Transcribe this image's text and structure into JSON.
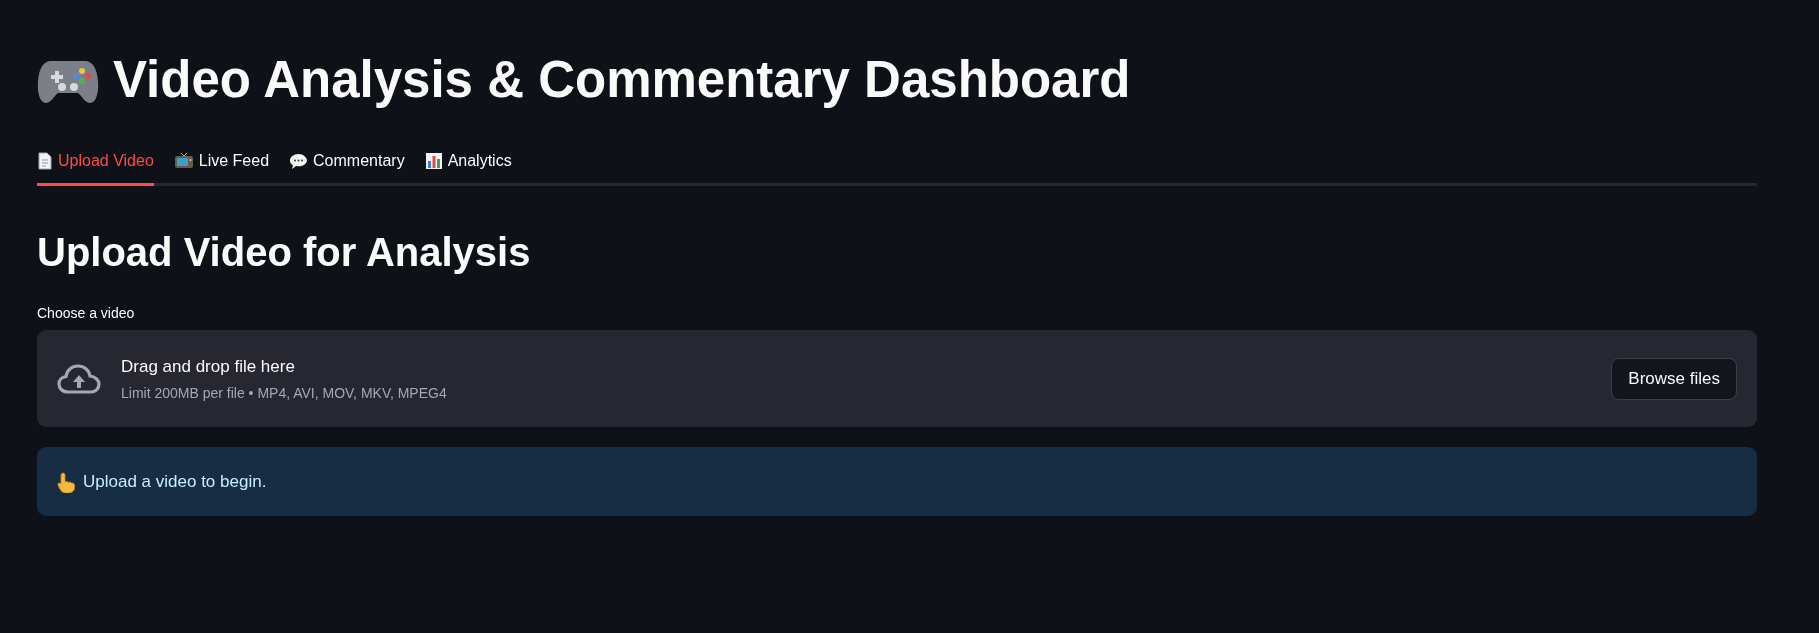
{
  "title": "Video Analysis & Commentary Dashboard",
  "tabs": [
    {
      "label": "Upload Video",
      "selected": true
    },
    {
      "label": "Live Feed",
      "selected": false
    },
    {
      "label": "Commentary",
      "selected": false
    },
    {
      "label": "Analytics",
      "selected": false
    }
  ],
  "section": {
    "heading": "Upload Video for Analysis"
  },
  "uploader": {
    "label": "Choose a video",
    "dropzone_text": "Drag and drop file here",
    "limit_text": "Limit 200MB per file • MP4, AVI, MOV, MKV, MPEG4",
    "button": "Browse files"
  },
  "info": {
    "message": "Upload a video to begin."
  }
}
